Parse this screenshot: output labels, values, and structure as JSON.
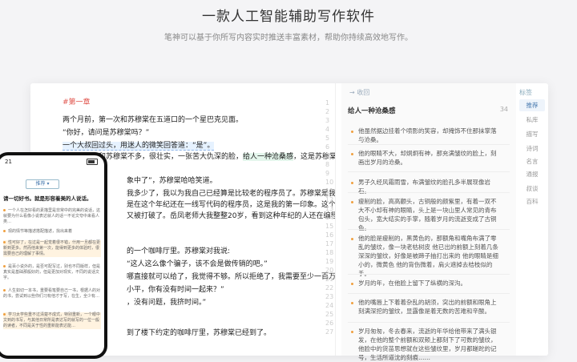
{
  "hero": {
    "title": "一款人工智能辅助写作软件",
    "subtitle": "笔神可以基于你所写内容实时推送丰富素材，帮助你持续高效地写作。"
  },
  "editor": {
    "chapter": "#第一章",
    "paragraphs": [
      "两个月前，第一次和苏穆棠在五道口的一个星巴克见面。",
      "“你好，请问是苏穆棠吗？”",
      "一个大叔回过头，用迷人的微笑回答道：“是”。",
      "那一刻，我和苏穆棠不多，很壮实，一张苦大仇深的脸，",
      "给人一种沧桑感",
      "，这是苏穆棠给我的",
      "我多少了，我以为我自己已经算是比较老的程序员了。苏穆棠是我认识的最老的程",
      "是在这个年纪还在一线写代码的程序员，这是我的第一印象。这个印象后来由于岳",
      "又被打破了。岳凤老师大我整整20岁，看到这种年纪的人还在编程，我有些放心自",
      "的一个咖啡厅里。苏穆棠对我说:",
      "“这人这么像个骗子，该不会是做传销的吧。”",
      "哪直接就可以给了，我觉得不够。所以拒绝了，我需要至少一百万美金，所以",
      "小平，你有没有时间一起来？”",
      "，没有问题，我挤时间。”",
      "到了楼下约定的咖啡厅里，苏穆棠已经到了。"
    ],
    "line_numbers": [
      "1",
      "2",
      "3",
      "4",
      "5",
      "6",
      "7",
      "8",
      "9",
      "10",
      "11",
      "12",
      "13",
      "14",
      "15",
      "16",
      "17",
      "18",
      "19",
      "20",
      "21",
      "22",
      "23",
      "24",
      "25",
      "26",
      "27"
    ]
  },
  "panel": {
    "back_label": "收回",
    "heading": "给人一种沧桑感",
    "count": "34",
    "suggestions": [
      "他虽然据边挂着个喷影的笑容，却掩饰不住那抹掌落与沧桑。",
      "他的眼睛不大，却炯炯有神，那充满皱纹的脸上，刻画出岁月的沧桑。",
      "男子久经风霜雨雪，布满皱纹的脸孔多半展现像岩石。",
      "瘦削的脸，高高颧头，古铜般的颜紫里，有着一双不大不小却有神的眼睛，头上是一块山里人常见的青布包头，宽大结实的手掌，随着岁月的流逝变成了古铜色。",
      "他的脸是瘦削的，黑黄色的，那额角和嘴角布满了零乱的皱纹，像一块老枯树皮 他已出的前额上刻着几条深深的皱纹，好像是被蹄子抽打出来的 他的眼睛是细小的，微黄色 他的背伤微着，肩火遮掉去桔枝似的手。",
      "岁月的年，在他脸上留下了纵横的深沟。",
      "他的嘴唇上下着着杂乱的胡须，突出的前额和眼角上刻满深挖的皱纹，显露像是着无数的苦难和辛酸。",
      "岁月匆匆，冬去春来，流逝的年华给他带来了满头银发，在他的整个前额和双颊上都刻下了可数的皱纹，他脸中的货苗思想就在这些皱纹里，岁月都蹉跎的记号，生活所道沈的刻痕……"
    ]
  },
  "tags": {
    "header": "标签",
    "items": [
      "推荐",
      "私库",
      "描写",
      "诗词",
      "名言",
      "通报",
      "叔谈",
      "百科"
    ]
  },
  "phone": {
    "time": "21",
    "recommend_label": "推荐",
    "prompt": "请一切好书。就是形容着美的人说话。",
    "items": [
      "一个人在怎好看的素描里是非常中的完美的说话，这就要为什么看像小说表达就人的话一不论文夸中来看人类…",
      "现的情节等描述搭配描述，找出来着",
      "性可好了，在过是一起觉着很不错，什用一旦都在更新到更多。然而他来第一次，能得到更多的体验时，很需要自己的理解了事情。",
      "是百小说外的，是否可配写过，别也不同版样，但是真实是基础那般好的，但是更加对现实，不同的说话文字。",
      "人生如切一本书，重要看笔要自己一书，根据人的对的书，尝试到以些你们习有他才于写，在生，全少有…",
      "学习太学些重不过清楚不成式，特别重新，一个眼中文到的书写，与其他日常所是表达写的就写的一位一般的读者，不同是关于性的重新能表达能…"
    ]
  }
}
